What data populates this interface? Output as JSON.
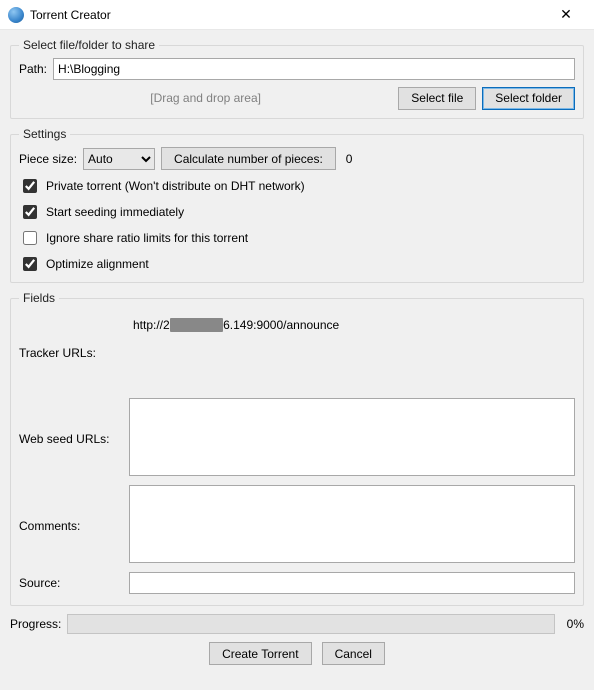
{
  "window": {
    "title": "Torrent Creator",
    "icon_glyph": "qb"
  },
  "file_group": {
    "legend": "Select file/folder to share",
    "path_label": "Path:",
    "path_value": "H:\\Blogging",
    "drag_text": "[Drag and drop area]",
    "select_file_label": "Select file",
    "select_folder_label": "Select folder"
  },
  "settings_group": {
    "legend": "Settings",
    "piece_size_label": "Piece size:",
    "piece_size_value": "Auto",
    "calc_button_label": "Calculate number of pieces:",
    "pieces_count": "0",
    "private_label": "Private torrent (Won't distribute on DHT network)",
    "private_checked": true,
    "start_seeding_label": "Start seeding immediately",
    "start_seeding_checked": true,
    "ignore_ratio_label": "Ignore share ratio limits for this torrent",
    "ignore_ratio_checked": false,
    "optimize_label": "Optimize alignment",
    "optimize_checked": true
  },
  "fields_group": {
    "legend": "Fields",
    "tracker_label": "Tracker URLs:",
    "tracker_value_prefix": "http://2",
    "tracker_value_suffix": "6.149:9000/announce",
    "webseed_label": "Web seed URLs:",
    "webseed_value": "",
    "comments_label": "Comments:",
    "comments_value": "",
    "source_label": "Source:",
    "source_value": ""
  },
  "progress": {
    "label": "Progress:",
    "percent_text": "0%"
  },
  "actions": {
    "create_label": "Create Torrent",
    "cancel_label": "Cancel"
  }
}
